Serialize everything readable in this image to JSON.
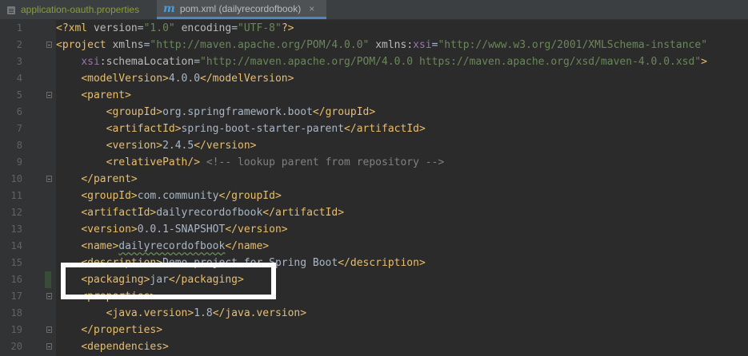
{
  "tabs": [
    {
      "label": "application-oauth.properties",
      "active": false,
      "icon": "properties-file-icon"
    },
    {
      "label": "pom.xml (dailyrecordofbook)",
      "active": true,
      "icon": "maven-icon"
    }
  ],
  "tab_icon_glyph": "m",
  "close_glyph": "×",
  "line_numbers": [
    "1",
    "2",
    "3",
    "4",
    "5",
    "6",
    "7",
    "8",
    "9",
    "10",
    "11",
    "12",
    "13",
    "14",
    "15",
    "16",
    "17",
    "18",
    "19",
    "20"
  ],
  "code": {
    "l1": {
      "open": "<?xml ",
      "a1": "version",
      "eq1": "=",
      "v1": "\"1.0\"",
      "sp": " ",
      "a2": "encoding",
      "eq2": "=",
      "v2": "\"UTF-8\"",
      "close": "?>"
    },
    "l2": {
      "open": "<project ",
      "a1": "xmlns",
      "eq1": "=",
      "v1": "\"http://maven.apache.org/POM/4.0.0\"",
      "sp": " ",
      "a2p": "xmlns:",
      "a2ns": "xsi",
      "eq2": "=",
      "v2": "\"http://www.w3.org/2001/XMLSchema-instance\""
    },
    "l3": {
      "indent": "    ",
      "ns": "xsi",
      "a": ":schemaLocation",
      "eq": "=",
      "v": "\"http://maven.apache.org/POM/4.0.0 https://maven.apache.org/xsd/maven-4.0.0.xsd\"",
      "close": ">"
    },
    "l4": {
      "indent": "    ",
      "open": "<modelVersion>",
      "text": "4.0.0",
      "close": "</modelVersion>"
    },
    "l5": {
      "indent": "    ",
      "open": "<parent>"
    },
    "l6": {
      "indent": "        ",
      "open": "<groupId>",
      "text": "org.springframework.boot",
      "close": "</groupId>"
    },
    "l7": {
      "indent": "        ",
      "open": "<artifactId>",
      "text": "spring-boot-starter-parent",
      "close": "</artifactId>"
    },
    "l8": {
      "indent": "        ",
      "open": "<version>",
      "text": "2.4.5",
      "close": "</version>"
    },
    "l9": {
      "indent": "        ",
      "open": "<relativePath/>",
      "comment": " <!-- lookup parent from repository -->"
    },
    "l10": {
      "indent": "    ",
      "close": "</parent>"
    },
    "l11": {
      "indent": "    ",
      "open": "<groupId>",
      "text": "com.community",
      "close": "</groupId>"
    },
    "l12": {
      "indent": "    ",
      "open": "<artifactId>",
      "text": "dailyrecordofbook",
      "close": "</artifactId>"
    },
    "l13": {
      "indent": "    ",
      "open": "<version>",
      "text": "0.0.1-SNAPSHOT",
      "close": "</version>"
    },
    "l14": {
      "indent": "    ",
      "open": "<name>",
      "text": "dailyrecordofbook",
      "close": "</name>"
    },
    "l15": {
      "indent": "    ",
      "open": "<description>",
      "text": "Demo project for Spring Boot",
      "close": "</description>"
    },
    "l16": {
      "indent": "    ",
      "open": "<packaging>",
      "text": "jar",
      "close": "</packaging>"
    },
    "l17": {
      "indent": "    ",
      "open": "<properties>"
    },
    "l18": {
      "indent": "        ",
      "open": "<java.version>",
      "text": "1.8",
      "close": "</java.version>"
    },
    "l19": {
      "indent": "    ",
      "close": "</properties>"
    },
    "l20": {
      "indent": "    ",
      "open": "<dependencies>"
    }
  },
  "colors": {
    "background": "#2b2b2b",
    "tag": "#e8bf6a",
    "attribute_value": "#6a8759",
    "namespace": "#9876aa",
    "comment": "#808080",
    "text": "#a9b7c6",
    "highlight_box": "#ffffff"
  }
}
